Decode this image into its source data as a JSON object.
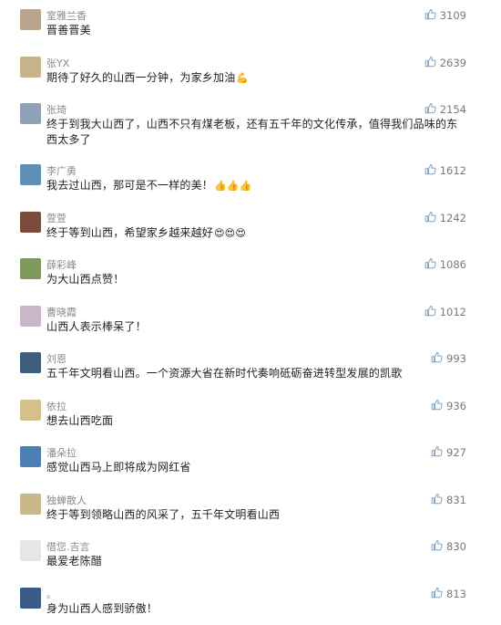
{
  "comments": [
    {
      "name": "室雅兰香",
      "text": "晋善晋美",
      "likes": "3109",
      "emoji": "",
      "avatar": "#b9a68c"
    },
    {
      "name": "张YX",
      "text": "期待了好久的山西一分钟，为家乡加油",
      "likes": "2639",
      "emoji": "💪",
      "avatar": "#c8b48a"
    },
    {
      "name": "张琦",
      "text": "终于到我大山西了，山西不只有煤老板，还有五千年的文化传承，值得我们品味的东西太多了",
      "likes": "2154",
      "emoji": "",
      "avatar": "#8fa3b8"
    },
    {
      "name": "李广勇",
      "text": "我去过山西，那可是不一样的美！",
      "likes": "1612",
      "emoji": "👍👍👍",
      "avatar": "#5f8fb5"
    },
    {
      "name": "萱萱",
      "text": "终于等到山西，希望家乡越来越好",
      "likes": "1242",
      "emoji": "😍😍😍",
      "avatar": "#7a4a3a"
    },
    {
      "name": "薛彩峰",
      "text": "为大山西点赞！",
      "likes": "1086",
      "emoji": "",
      "avatar": "#7e9a5a"
    },
    {
      "name": "曹晓霞",
      "text": "山西人表示棒呆了！",
      "likes": "1012",
      "emoji": "",
      "avatar": "#c9b6c8"
    },
    {
      "name": "刘恩",
      "text": "五千年文明看山西。一个资源大省在新时代奏响砥砺奋进转型发展的凯歌",
      "likes": "993",
      "emoji": "",
      "avatar": "#3e5e7e"
    },
    {
      "name": "依拉",
      "text": "想去山西吃面",
      "likes": "936",
      "emoji": "",
      "avatar": "#d4c08a"
    },
    {
      "name": "潘朵拉",
      "text": "感觉山西马上即将成为网红省",
      "likes": "927",
      "emoji": "",
      "avatar": "#4d7fb5"
    },
    {
      "name": "独蝉散人",
      "text": "终于等到领略山西的风采了，五千年文明看山西",
      "likes": "831",
      "emoji": "",
      "avatar": "#c9b88a"
    },
    {
      "name": "借您.吉言",
      "text": "最爱老陈醋",
      "likes": "830",
      "emoji": "",
      "avatar": "#e6e6e6"
    },
    {
      "name": "。",
      "text": "身为山西人感到骄傲！",
      "likes": "813",
      "emoji": "",
      "avatar": "#3a5a8a"
    }
  ]
}
